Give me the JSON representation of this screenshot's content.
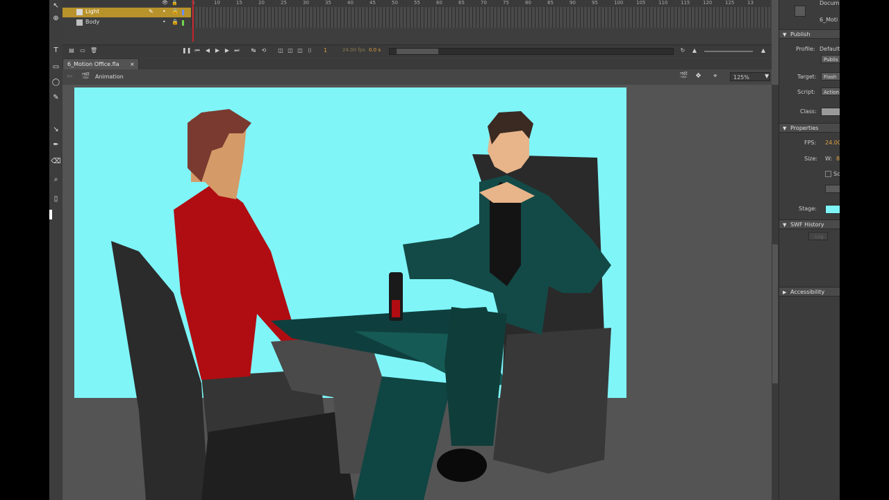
{
  "timeline": {
    "layers": [
      {
        "name": "Light",
        "selected": true
      },
      {
        "name": "Body",
        "selected": false
      }
    ],
    "ruler": [
      "5",
      "10",
      "15",
      "20",
      "25",
      "30",
      "35",
      "40",
      "45",
      "50",
      "55",
      "60",
      "65",
      "70",
      "75",
      "80",
      "85",
      "90",
      "95",
      "100",
      "105",
      "110",
      "115",
      "120",
      "125",
      "13"
    ],
    "frame_number": "1",
    "fps_display": "24.00 fps",
    "time_display": "0.0 s"
  },
  "document": {
    "tab_title": "6_Motion Office.fla",
    "close_label": "×",
    "scene_name": "Animation",
    "zoom": "125%"
  },
  "stage": {
    "color": "#7ff5f8"
  },
  "properties": {
    "doc_label": "Docum",
    "doc_name": "6_Moti",
    "publish_header": "Publish",
    "profile_label": "Profile:",
    "profile_value": "Default",
    "publish_button": "Publis",
    "target_label": "Target:",
    "target_value": "Flash",
    "script_label": "Script:",
    "script_value": "Action",
    "class_label": "Class:",
    "properties_header": "Properties",
    "fps_label": "FPS:",
    "fps_value": "24.00",
    "size_label": "Size:",
    "w_label": "W:",
    "w_value": "8",
    "scale_label": "Sc",
    "stage_label": "Stage:",
    "swf_header": "SWF History",
    "log_button": "Log",
    "accessibility_header": "Accessibility"
  }
}
